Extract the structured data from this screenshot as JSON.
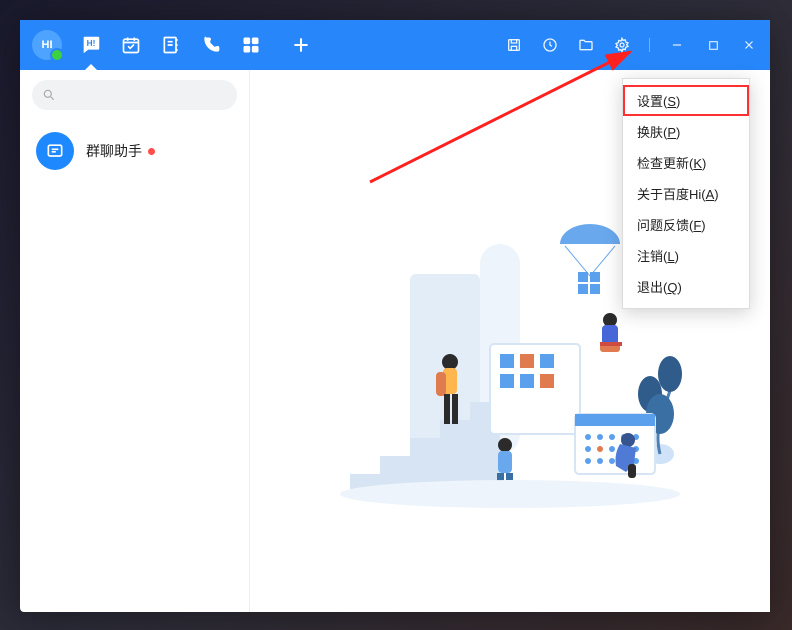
{
  "avatar_text": "HI",
  "sidebar": {
    "search_placeholder": "",
    "chat": {
      "name": "群聊助手"
    }
  },
  "menu": {
    "items": [
      {
        "pre": "设置(",
        "u": "S",
        "post": ")"
      },
      {
        "pre": "换肤(",
        "u": "P",
        "post": ")"
      },
      {
        "pre": "检查更新(",
        "u": "K",
        "post": ")"
      },
      {
        "pre": "关于百度Hi(",
        "u": "A",
        "post": ")"
      },
      {
        "pre": "问题反馈(",
        "u": "F",
        "post": ")"
      },
      {
        "pre": "注销(",
        "u": "L",
        "post": ")"
      },
      {
        "pre": "退出(",
        "u": "Q",
        "post": ")"
      }
    ]
  }
}
